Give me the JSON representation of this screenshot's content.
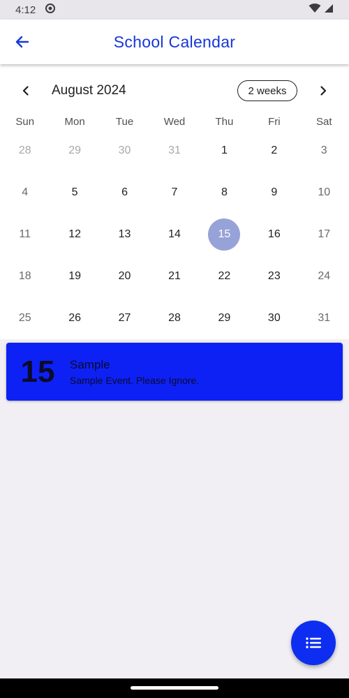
{
  "status_bar": {
    "time": "4:12"
  },
  "app_bar": {
    "title": "School Calendar"
  },
  "colors": {
    "accent": "#1637d9",
    "event_bg": "#0d21f5",
    "fab_bg": "#0d2ef0",
    "selected_day": "#97a3d8"
  },
  "calendar": {
    "month_label": "August 2024",
    "format_button": "2 weeks",
    "weekdays": [
      "Sun",
      "Mon",
      "Tue",
      "Wed",
      "Thu",
      "Fri",
      "Sat"
    ],
    "selected_day": "15",
    "weeks": [
      [
        "28",
        "29",
        "30",
        "31",
        "1",
        "2",
        "3"
      ],
      [
        "4",
        "5",
        "6",
        "7",
        "8",
        "9",
        "10"
      ],
      [
        "11",
        "12",
        "13",
        "14",
        "15",
        "16",
        "17"
      ],
      [
        "18",
        "19",
        "20",
        "21",
        "22",
        "23",
        "24"
      ],
      [
        "25",
        "26",
        "27",
        "28",
        "29",
        "30",
        "31"
      ]
    ]
  },
  "events": [
    {
      "day": "15",
      "title": "Sample",
      "description": "Sample Event. Please Ignore."
    }
  ],
  "icons": {
    "back": "arrow-left-icon",
    "prev": "chevron-left-icon",
    "next": "chevron-right-icon",
    "fab": "list-icon"
  }
}
